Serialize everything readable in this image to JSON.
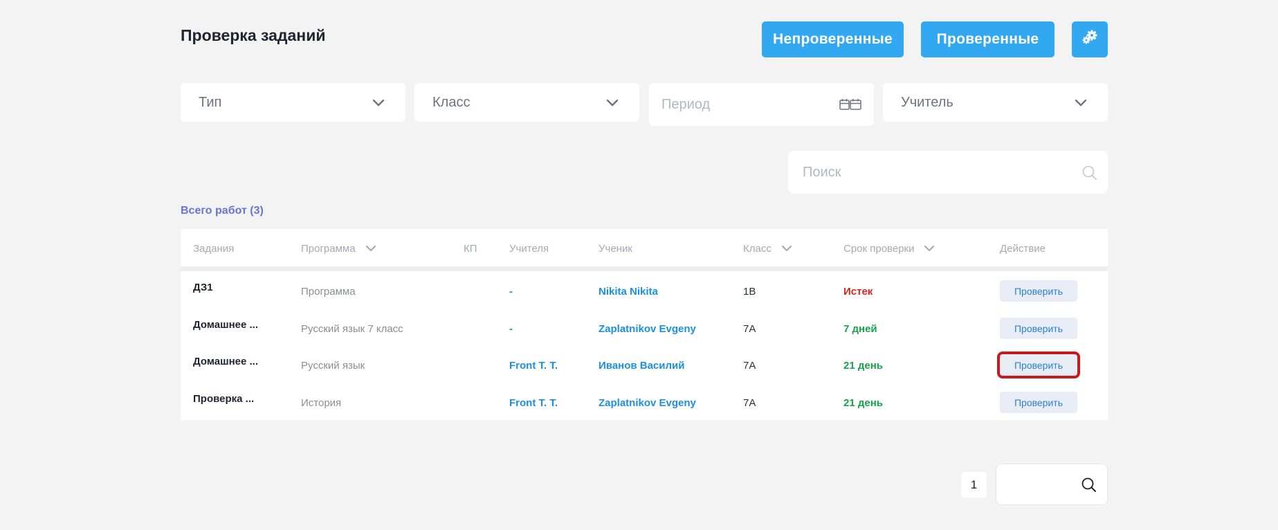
{
  "header": {
    "title": "Проверка заданий",
    "unchecked_label": "Непроверенные",
    "checked_label": "Проверенные",
    "settings_icon": "gears-icon"
  },
  "filters": {
    "type_placeholder": "Тип",
    "class_placeholder": "Класс",
    "period_placeholder": "Период",
    "teacher_placeholder": "Учитель"
  },
  "search": {
    "placeholder": "Поиск"
  },
  "summary": {
    "total_label": "Всего работ",
    "total_count": "(3)"
  },
  "table": {
    "columns": {
      "task": "Задания",
      "program": "Программа",
      "kp": "КП",
      "teachers": "Учителя",
      "student": "Ученик",
      "class": "Класс",
      "deadline": "Срок проверки",
      "action": "Действие"
    },
    "rows": [
      {
        "task": "ДЗ1",
        "program": "Программа",
        "teacher": "-",
        "student": "Nikita Nikita",
        "class": "1В",
        "deadline": "Истек",
        "deadline_color": "#d9261c",
        "action": "Проверить"
      },
      {
        "task": "Домашнее ...",
        "program": "Русский язык 7 класс",
        "teacher": "-",
        "student": "Zaplatnikov Evgeny",
        "class": "7А",
        "deadline": "7 дней",
        "deadline_color": "#17a34a",
        "action": "Проверить"
      },
      {
        "task": "Домашнее ...",
        "program": "Русский язык",
        "teacher": "Front T. T.",
        "student": "Иванов Василий",
        "class": "7А",
        "deadline": "21 день",
        "deadline_color": "#17a34a",
        "action": "Проверить"
      },
      {
        "task": "Проверка ...",
        "program": "История",
        "teacher": "Front T. T.",
        "student": "Zaplatnikov Evgeny",
        "class": "7А",
        "deadline": "21 день",
        "deadline_color": "#17a34a",
        "action": "Проверить"
      }
    ]
  },
  "pagination": {
    "current_page": "1"
  },
  "colors": {
    "accent": "#33a8f2",
    "link": "#1a8fe3",
    "expired": "#d9261c",
    "ok": "#17a34a",
    "highlight": "#c8191c"
  }
}
